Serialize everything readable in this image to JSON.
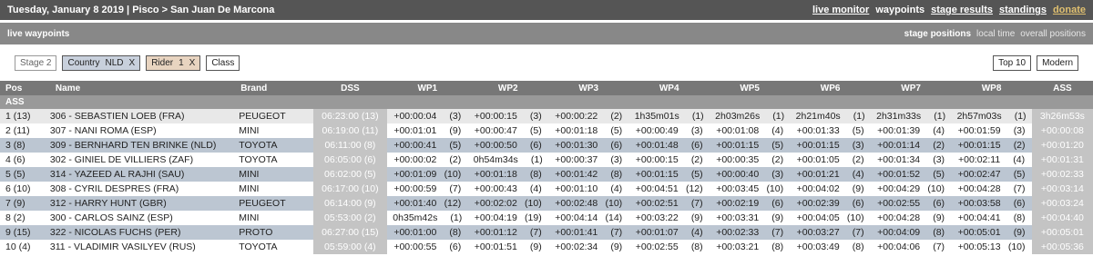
{
  "header": {
    "title": "Tuesday, January 8 2019 | Pisco > San Juan De Marcona",
    "nav": [
      "live monitor",
      "waypoints",
      "stage results",
      "standings",
      "donate"
    ]
  },
  "subheader": {
    "title": "live waypoints",
    "nav": [
      "stage positions",
      "local time",
      "overall positions"
    ]
  },
  "filters": {
    "stage": "Stage 2",
    "country_label": "Country",
    "country_value": "NLD",
    "rider_label": "Rider",
    "rider_value": "1",
    "close": "X",
    "class": "Class",
    "top10": "Top 10",
    "modern": "Modern"
  },
  "table": {
    "headers": [
      "Pos",
      "Name",
      "Brand",
      "DSS",
      "WP1",
      "WP2",
      "WP3",
      "WP4",
      "WP5",
      "WP6",
      "WP7",
      "WP8",
      "ASS"
    ],
    "section": "ASS",
    "rows": [
      {
        "pos": "1",
        "rank": "(13)",
        "name": "306 - SEBASTIEN LOEB (FRA)",
        "brand": "PEUGEOT",
        "dss": "06:23:00",
        "dssr": "(13)",
        "wp": [
          [
            "+00:00:04",
            "(3)"
          ],
          [
            "+00:00:15",
            "(3)"
          ],
          [
            "+00:00:22",
            "(2)"
          ],
          [
            "1h35m01s",
            "(1)"
          ],
          [
            "2h03m26s",
            "(1)"
          ],
          [
            "2h21m40s",
            "(1)"
          ],
          [
            "2h31m33s",
            "(1)"
          ],
          [
            "2h57m03s",
            "(1)"
          ]
        ],
        "ass": "3h26m53s"
      },
      {
        "pos": "2",
        "rank": "(11)",
        "name": "307 - NANI ROMA (ESP)",
        "brand": "MINI",
        "dss": "06:19:00",
        "dssr": "(11)",
        "wp": [
          [
            "+00:01:01",
            "(9)"
          ],
          [
            "+00:00:47",
            "(5)"
          ],
          [
            "+00:01:18",
            "(5)"
          ],
          [
            "+00:00:49",
            "(3)"
          ],
          [
            "+00:01:08",
            "(4)"
          ],
          [
            "+00:01:33",
            "(5)"
          ],
          [
            "+00:01:39",
            "(4)"
          ],
          [
            "+00:01:59",
            "(3)"
          ]
        ],
        "ass": "+00:00:08"
      },
      {
        "pos": "3",
        "rank": "(8)",
        "name": "309 - BERNHARD TEN BRINKE (NLD)",
        "brand": "TOYOTA",
        "dss": "06:11:00",
        "dssr": "(8)",
        "wp": [
          [
            "+00:00:41",
            "(5)"
          ],
          [
            "+00:00:50",
            "(6)"
          ],
          [
            "+00:01:30",
            "(6)"
          ],
          [
            "+00:01:48",
            "(6)"
          ],
          [
            "+00:01:15",
            "(5)"
          ],
          [
            "+00:01:15",
            "(3)"
          ],
          [
            "+00:01:14",
            "(2)"
          ],
          [
            "+00:01:15",
            "(2)"
          ]
        ],
        "ass": "+00:01:20"
      },
      {
        "pos": "4",
        "rank": "(6)",
        "name": "302 - GINIEL DE VILLIERS (ZAF)",
        "brand": "TOYOTA",
        "dss": "06:05:00",
        "dssr": "(6)",
        "wp": [
          [
            "+00:00:02",
            "(2)"
          ],
          [
            "0h54m34s",
            "(1)"
          ],
          [
            "+00:00:37",
            "(3)"
          ],
          [
            "+00:00:15",
            "(2)"
          ],
          [
            "+00:00:35",
            "(2)"
          ],
          [
            "+00:01:05",
            "(2)"
          ],
          [
            "+00:01:34",
            "(3)"
          ],
          [
            "+00:02:11",
            "(4)"
          ]
        ],
        "ass": "+00:01:31"
      },
      {
        "pos": "5",
        "rank": "(5)",
        "name": "314 - YAZEED AL RAJHI (SAU)",
        "brand": "MINI",
        "dss": "06:02:00",
        "dssr": "(5)",
        "wp": [
          [
            "+00:01:09",
            "(10)"
          ],
          [
            "+00:01:18",
            "(8)"
          ],
          [
            "+00:01:42",
            "(8)"
          ],
          [
            "+00:01:15",
            "(5)"
          ],
          [
            "+00:00:40",
            "(3)"
          ],
          [
            "+00:01:21",
            "(4)"
          ],
          [
            "+00:01:52",
            "(5)"
          ],
          [
            "+00:02:47",
            "(5)"
          ]
        ],
        "ass": "+00:02:33"
      },
      {
        "pos": "6",
        "rank": "(10)",
        "name": "308 - CYRIL DESPRES (FRA)",
        "brand": "MINI",
        "dss": "06:17:00",
        "dssr": "(10)",
        "wp": [
          [
            "+00:00:59",
            "(7)"
          ],
          [
            "+00:00:43",
            "(4)"
          ],
          [
            "+00:01:10",
            "(4)"
          ],
          [
            "+00:04:51",
            "(12)"
          ],
          [
            "+00:03:45",
            "(10)"
          ],
          [
            "+00:04:02",
            "(9)"
          ],
          [
            "+00:04:29",
            "(10)"
          ],
          [
            "+00:04:28",
            "(7)"
          ]
        ],
        "ass": "+00:03:14"
      },
      {
        "pos": "7",
        "rank": "(9)",
        "name": "312 - HARRY HUNT (GBR)",
        "brand": "PEUGEOT",
        "dss": "06:14:00",
        "dssr": "(9)",
        "wp": [
          [
            "+00:01:40",
            "(12)"
          ],
          [
            "+00:02:02",
            "(10)"
          ],
          [
            "+00:02:48",
            "(10)"
          ],
          [
            "+00:02:51",
            "(7)"
          ],
          [
            "+00:02:19",
            "(6)"
          ],
          [
            "+00:02:39",
            "(6)"
          ],
          [
            "+00:02:55",
            "(6)"
          ],
          [
            "+00:03:58",
            "(6)"
          ]
        ],
        "ass": "+00:03:24"
      },
      {
        "pos": "8",
        "rank": "(2)",
        "name": "300 - CARLOS SAINZ (ESP)",
        "brand": "MINI",
        "dss": "05:53:00",
        "dssr": "(2)",
        "wp": [
          [
            "0h35m42s",
            "(1)"
          ],
          [
            "+00:04:19",
            "(19)"
          ],
          [
            "+00:04:14",
            "(14)"
          ],
          [
            "+00:03:22",
            "(9)"
          ],
          [
            "+00:03:31",
            "(9)"
          ],
          [
            "+00:04:05",
            "(10)"
          ],
          [
            "+00:04:28",
            "(9)"
          ],
          [
            "+00:04:41",
            "(8)"
          ]
        ],
        "ass": "+00:04:40"
      },
      {
        "pos": "9",
        "rank": "(15)",
        "name": "322 - NICOLAS FUCHS (PER)",
        "brand": "PROTO",
        "dss": "06:27:00",
        "dssr": "(15)",
        "wp": [
          [
            "+00:01:00",
            "(8)"
          ],
          [
            "+00:01:12",
            "(7)"
          ],
          [
            "+00:01:41",
            "(7)"
          ],
          [
            "+00:01:07",
            "(4)"
          ],
          [
            "+00:02:33",
            "(7)"
          ],
          [
            "+00:03:27",
            "(7)"
          ],
          [
            "+00:04:09",
            "(8)"
          ],
          [
            "+00:05:01",
            "(9)"
          ]
        ],
        "ass": "+00:05:01"
      },
      {
        "pos": "10",
        "rank": "(4)",
        "name": "311 - VLADIMIR VASILYEV (RUS)",
        "brand": "TOYOTA",
        "dss": "05:59:00",
        "dssr": "(4)",
        "wp": [
          [
            "+00:00:55",
            "(6)"
          ],
          [
            "+00:01:51",
            "(9)"
          ],
          [
            "+00:02:34",
            "(9)"
          ],
          [
            "+00:02:55",
            "(8)"
          ],
          [
            "+00:03:21",
            "(8)"
          ],
          [
            "+00:03:49",
            "(8)"
          ],
          [
            "+00:04:06",
            "(7)"
          ],
          [
            "+00:05:13",
            "(10)"
          ]
        ],
        "ass": "+00:05:36"
      }
    ],
    "highlight_rows": [
      3,
      5,
      7,
      9
    ]
  }
}
